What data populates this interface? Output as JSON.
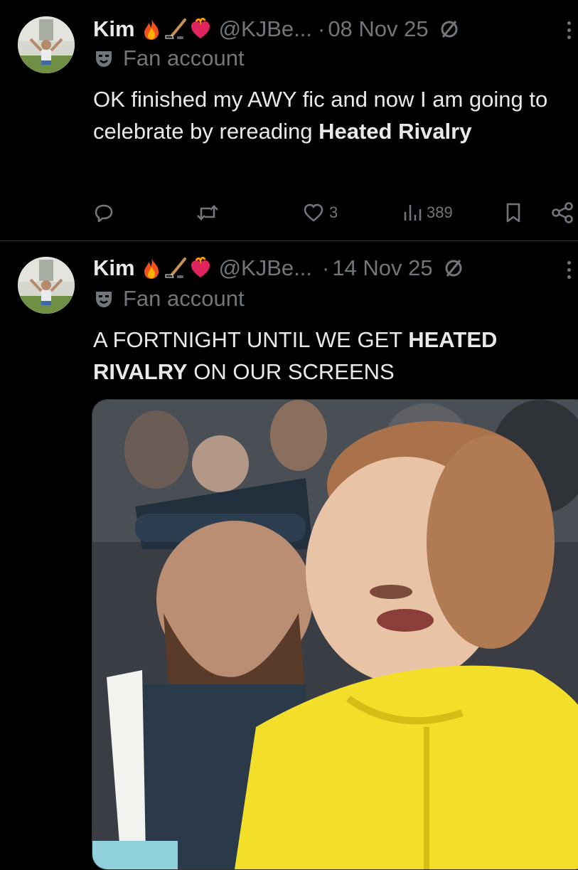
{
  "tweets": [
    {
      "name": "Kim",
      "handle": "@KJBe...",
      "dot": "·",
      "date": "08 Nov 25",
      "label": "Fan account",
      "text_parts": [
        "OK finished my AWY fic and now I am going to celebrate by rereading ",
        "Heated Rivalry"
      ],
      "actions": {
        "reply": "",
        "retweet": "",
        "like_count": "3",
        "view_count": "389"
      },
      "icons": [
        "fire-emoji-icon",
        "hockey-stick-emoji-icon",
        "heart-on-fire-emoji-icon",
        "hidden-reply-icon",
        "more-icon",
        "mask-icon",
        "reply-icon",
        "retweet-icon",
        "like-icon",
        "views-icon",
        "bookmark-icon",
        "share-icon"
      ]
    },
    {
      "name": "Kim",
      "handle": "@KJBe...",
      "dot": "·",
      "date": "14 Nov 25",
      "label": "Fan account",
      "text_parts": [
        "A FORTNIGHT UNTIL WE GET ",
        "HEATED RIVALRY",
        " ON OUR SCREENS"
      ],
      "media": "video-gif-thumbnail"
    }
  ],
  "colors": {
    "background": "#000000",
    "text": "#e7e9ea",
    "secondary": "#71767b",
    "divider": "#2f3336"
  }
}
